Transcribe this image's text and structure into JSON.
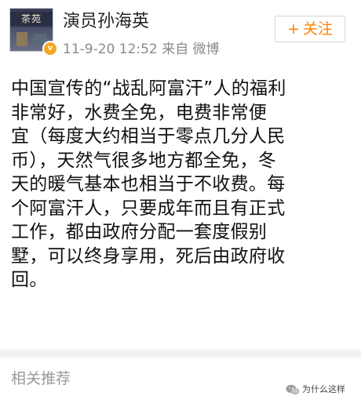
{
  "post": {
    "avatar_sign": "茶苑",
    "username": "演员孙海英",
    "timestamp": "11-9-20 12:52",
    "source": "来自 微博",
    "follow_label": "关注",
    "content_lines": [
      "中国宣传的“战乱阿富汗”人的福利",
      "非常好，水费全免，电费非常便",
      "宜（每度大约相当于零点几分人民",
      "币），天然气很多地方都全免，冬",
      "天的暖气基本也相当于不收费。每",
      "个阿富汗人，只要成年而且有正式",
      "工作，都由政府分配一套度假别",
      "墅，可以终身享用，死后由政府收",
      "回。"
    ]
  },
  "related": {
    "title": "相关推荐"
  },
  "watermark": {
    "text": "为什么这样"
  },
  "colors": {
    "accent": "#ff8200",
    "muted": "#8a8a8a",
    "badge": "#f5a623"
  }
}
